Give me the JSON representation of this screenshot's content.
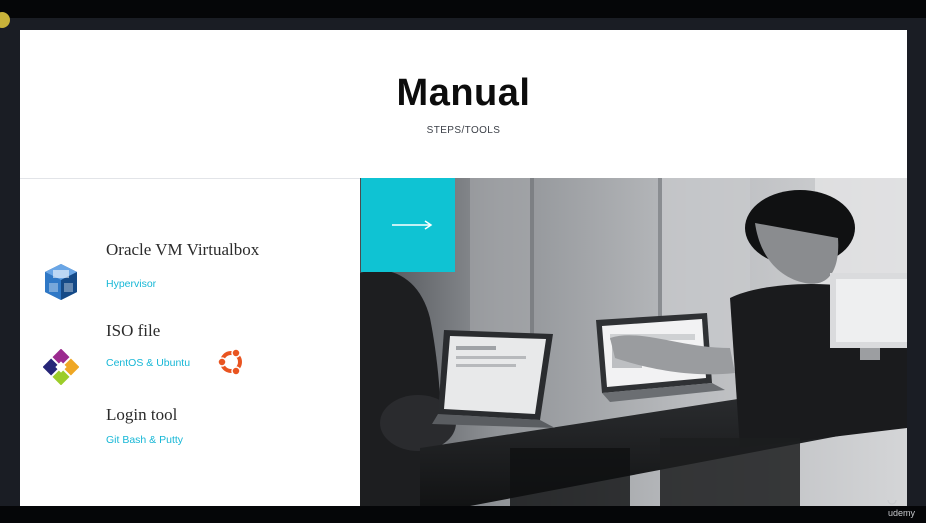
{
  "slide": {
    "title": "Manual",
    "subtitle": "STEPS/TOOLS"
  },
  "items": [
    {
      "heading": "Oracle VM Virtualbox",
      "sub": "Hypervisor",
      "icon": "virtualbox-icon"
    },
    {
      "heading": "ISO file",
      "sub": "CentOS & Ubuntu",
      "icons": [
        "centos-icon",
        "ubuntu-icon"
      ]
    },
    {
      "heading": "Login tool",
      "sub": "Git Bash & Putty"
    }
  ],
  "accent_box": {
    "icon": "arrow-right-icon",
    "color": "#0fc3d3"
  },
  "colors": {
    "accent": "#17b7d6",
    "title": "#0c0c0c",
    "slide_bg": "#ffffff",
    "frame_bg": "#050608"
  },
  "watermark": {
    "brand": "udemy"
  }
}
